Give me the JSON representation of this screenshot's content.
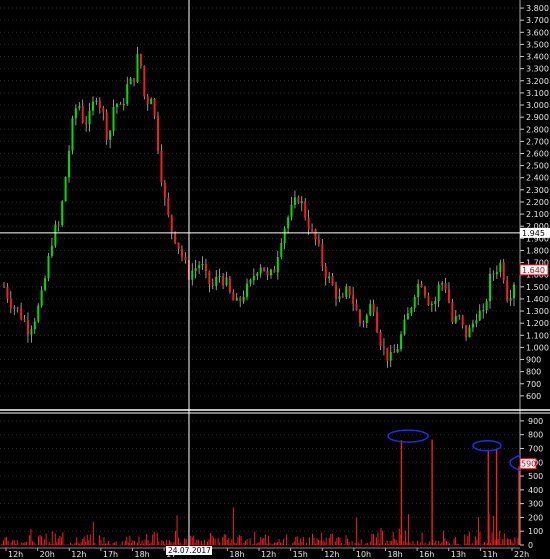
{
  "chart_data": [
    {
      "type": "candlestick",
      "ylim": [
        500,
        3850
      ],
      "y_ticks": [
        600,
        700,
        800,
        900,
        1000,
        1100,
        1200,
        1300,
        1400,
        1500,
        1600,
        1700,
        1800,
        1900,
        2000,
        2100,
        2200,
        2300,
        2400,
        2500,
        2600,
        2700,
        2800,
        2900,
        3000,
        3100,
        3200,
        3300,
        3400,
        3500,
        3600,
        3700,
        3800
      ],
      "y_tick_labels": [
        "600",
        "700",
        "800",
        "900",
        "1.000",
        "1.100",
        "1.200",
        "1.300",
        "1.400",
        "1.500",
        "1.600",
        "1.700",
        "1.800",
        "1.900",
        "2.000",
        "2.100",
        "2.200",
        "2.300",
        "2.400",
        "2.500",
        "2.600",
        "2.700",
        "2.800",
        "2.900",
        "3.000",
        "3.100",
        "3.200",
        "3.300",
        "3.400",
        "3.500",
        "3.600",
        "3.700",
        "3.800"
      ],
      "crosshair_price": 1945,
      "crosshair_label": "1.945",
      "last_price": 1640,
      "last_price_label": "1.640",
      "colors": {
        "up": "#00dd00",
        "down": "#ee2020",
        "wick": "#d0d0d0",
        "grid": "#2a2a2a",
        "crosshair": "#ffffff"
      },
      "price_path": [
        1500,
        1380,
        1320,
        1250,
        1150,
        1250,
        1380,
        1650,
        1950,
        2000,
        2400,
        2800,
        3050,
        2850,
        2900,
        3100,
        2950,
        2700,
        3050,
        2950,
        3150,
        3200,
        3450,
        3000,
        3100,
        2700,
        2250,
        2000,
        1900,
        1750,
        1600,
        1650,
        1700,
        1550,
        1500,
        1600,
        1550,
        1400,
        1350,
        1450,
        1500,
        1650,
        1700,
        1550,
        1650,
        1900,
        2050,
        2150,
        2250,
        2100,
        1950,
        1850,
        1650,
        1550,
        1450,
        1350,
        1500,
        1350,
        1200,
        1250,
        1400,
        1100,
        950,
        900,
        1000,
        1150,
        1300,
        1500,
        1550,
        1400,
        1350,
        1550,
        1500,
        1200,
        1250,
        1100,
        1150,
        1300,
        1250,
        1550,
        1650,
        1700,
        1400,
        1550
      ]
    },
    {
      "type": "bar",
      "ylim": [
        0,
        950
      ],
      "y_ticks": [
        0,
        100,
        200,
        300,
        400,
        500,
        600,
        700,
        800,
        900
      ],
      "y_tick_labels": [
        "0",
        "100",
        "200",
        "300",
        "400",
        "500",
        "600",
        "700",
        "800",
        "900"
      ],
      "last_value_label": "590",
      "spikes": [
        {
          "frac": 0.772,
          "value": 760
        },
        {
          "frac": 0.831,
          "value": 765
        },
        {
          "frac": 0.939,
          "value": 690
        },
        {
          "frac": 0.955,
          "value": 690
        },
        {
          "frac": 0.998,
          "value": 570
        }
      ],
      "colors": {
        "bar": "#ee2020",
        "marker": "#2030e0"
      }
    }
  ],
  "x_axis": {
    "labels": [
      "12h",
      "20h",
      "12h",
      "17h",
      "18h",
      "17",
      "24.07.2017",
      "18h",
      "12h",
      "15h",
      "12h",
      "10h",
      "18h",
      "16h",
      "13h",
      "11h",
      "22h"
    ],
    "crosshair_date_label": "24.07.2017"
  }
}
